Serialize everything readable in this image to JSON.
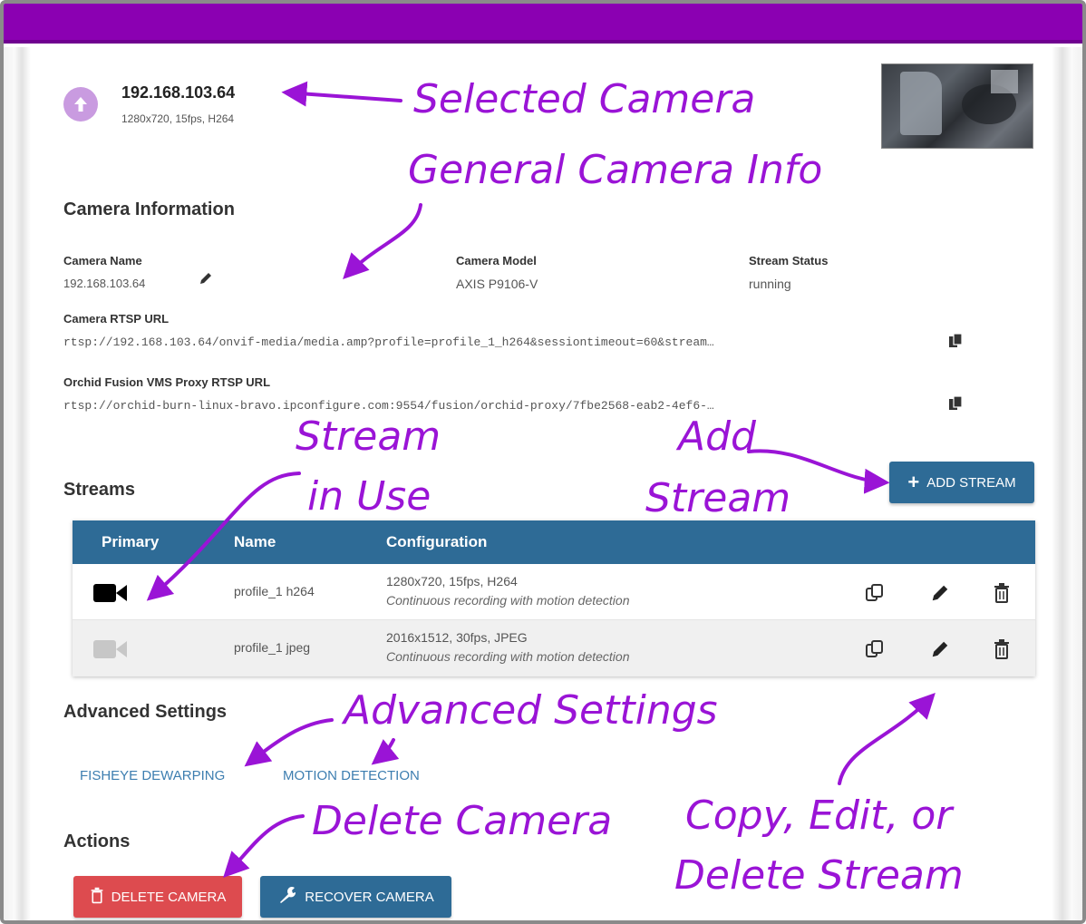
{
  "camera": {
    "title": "192.168.103.64",
    "subtitle": "1280x720, 15fps, H264"
  },
  "camera_info": {
    "heading": "Camera Information",
    "name_label": "Camera Name",
    "name_value": "192.168.103.64",
    "model_label": "Camera Model",
    "model_value": "AXIS P9106-V",
    "status_label": "Stream Status",
    "status_value": "running",
    "rtsp_label": "Camera RTSP URL",
    "rtsp_value": "rtsp://192.168.103.64/onvif-media/media.amp?profile=profile_1_h264&sessiontimeout=60&stream…",
    "proxy_label": "Orchid Fusion VMS Proxy RTSP URL",
    "proxy_value": "rtsp://orchid-burn-linux-bravo.ipconfigure.com:9554/fusion/orchid-proxy/7fbe2568-eab2-4ef6-…"
  },
  "streams": {
    "heading": "Streams",
    "add_label": "ADD STREAM",
    "columns": [
      "Primary",
      "Name",
      "Configuration"
    ],
    "rows": [
      {
        "name": "profile_1 h264",
        "config": "1280x720, 15fps, H264",
        "recording": "Continuous recording with motion detection",
        "primary": true
      },
      {
        "name": "profile_1 jpeg",
        "config": "2016x1512, 30fps, JPEG",
        "recording": "Continuous recording with motion detection",
        "primary": false
      }
    ]
  },
  "advanced": {
    "heading": "Advanced Settings",
    "links": [
      "FISHEYE DEWARPING",
      "MOTION DETECTION"
    ]
  },
  "actions": {
    "heading": "Actions",
    "delete_label": "DELETE CAMERA",
    "recover_label": "RECOVER CAMERA"
  },
  "annotations": {
    "selected_camera": "Selected Camera",
    "general_info": "General Camera Info",
    "stream_in_use_1": "Stream",
    "stream_in_use_2": "in Use",
    "add_stream_1": "Add",
    "add_stream_2": "Stream",
    "advanced_settings": "Advanced Settings",
    "delete_camera": "Delete Camera",
    "copy_edit_1": "Copy, Edit, or",
    "copy_edit_2": "Delete Stream"
  },
  "colors": {
    "header": "#8b00b2",
    "accent_blue": "#2e6b96",
    "danger": "#dd4b4f",
    "annotation": "#9a14d6"
  },
  "icons": [
    "arrow-up-circle-icon",
    "pencil-icon",
    "copy-icon",
    "plus-icon",
    "video-camera-icon",
    "duplicate-icon",
    "trash-icon",
    "wrench-icon"
  ]
}
